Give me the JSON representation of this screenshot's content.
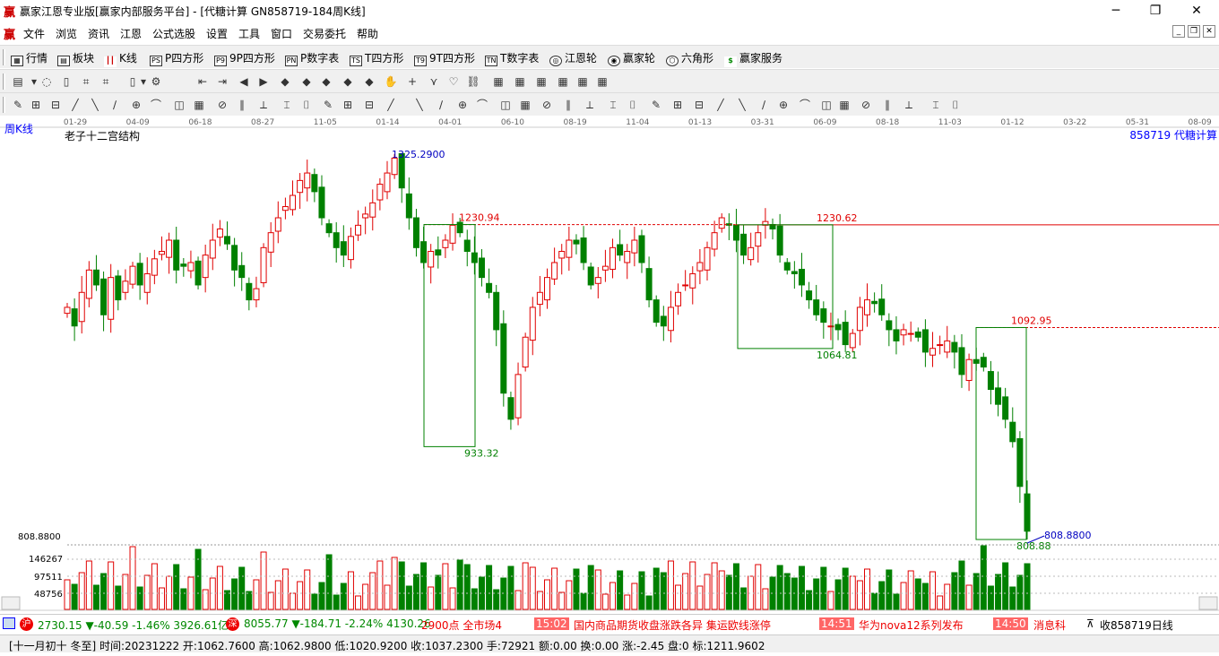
{
  "window": {
    "title": "赢家江恩专业版[赢家内部服务平台] - [代糖计算  GN858719-184周K线]",
    "logo": "赢"
  },
  "menu": [
    "文件",
    "浏览",
    "资讯",
    "江恩",
    "公式选股",
    "设置",
    "工具",
    "窗口",
    "交易委托",
    "帮助"
  ],
  "toolbar1": [
    {
      "icon": "grid-icon",
      "label": "行情"
    },
    {
      "icon": "blocks-icon",
      "label": "板块"
    },
    {
      "icon": "kline-icon",
      "label": "K线"
    },
    {
      "icon": "ps-icon",
      "label": "P四方形",
      "glyph": "PS"
    },
    {
      "icon": "p9-icon",
      "label": "9P四方形",
      "glyph": "P9"
    },
    {
      "icon": "pn-icon",
      "label": "P数字表",
      "glyph": "PN"
    },
    {
      "icon": "ts-icon",
      "label": "T四方形",
      "glyph": "TS"
    },
    {
      "icon": "t9-icon",
      "label": "9T四方形",
      "glyph": "T9"
    },
    {
      "icon": "tn-icon",
      "label": "T数字表",
      "glyph": "TN"
    },
    {
      "icon": "gann-wheel-icon",
      "label": "江恩轮"
    },
    {
      "icon": "winner-wheel-icon",
      "label": "赢家轮"
    },
    {
      "icon": "hexagon-icon",
      "label": "六角形"
    },
    {
      "icon": "dollar-icon",
      "label": "赢家服务"
    }
  ],
  "chart": {
    "period": "周K线",
    "indicator": "老子十二宫结构",
    "code_label": "858719  代糖计算",
    "date_ticks": [
      "01-29",
      "04-09",
      "06-18",
      "08-27",
      "11-05",
      "01-14",
      "04-01",
      "06-10",
      "08-19",
      "11-04",
      "01-13",
      "03-31",
      "06-09",
      "08-18",
      "11-03",
      "01-12",
      "03-22",
      "05-31",
      "08-09"
    ],
    "labels": {
      "high": "1325.2900",
      "r1": "1230.94",
      "r2": "1230.62",
      "r3": "1092.95",
      "s1": "933.32",
      "s2": "1064.81",
      "s3": "808.88",
      "low_right": "808.8800",
      "low_left": "808.8800",
      "vol1": "146267",
      "vol2": "97511",
      "vol3": "48756"
    },
    "colors": {
      "up": "#e00000",
      "down": "#008000",
      "box": "#008000",
      "resist": "#e00000",
      "price_label": "#0000c0"
    }
  },
  "chart_data": {
    "type": "candlestick",
    "title": "老子十二宫结构",
    "price_range": [
      808.88,
      1325.29
    ],
    "annotations": [
      {
        "label": "1325.2900",
        "value": 1325.29
      },
      {
        "label": "1230.94",
        "value": 1230.94
      },
      {
        "label": "1230.62",
        "value": 1230.62
      },
      {
        "label": "1092.95",
        "value": 1092.95
      },
      {
        "label": "933.32",
        "value": 933.32
      },
      {
        "label": "1064.81",
        "value": 1064.81
      },
      {
        "label": "808.88",
        "value": 808.88
      }
    ],
    "last_bar": {
      "open": 1062.76,
      "high": 1062.98,
      "low": 1020.92,
      "close": 1037.23,
      "volume": 72921
    },
    "closes": [
      1120,
      1095,
      1140,
      1170,
      1150,
      1110,
      1160,
      1130,
      1155,
      1175,
      1150,
      1165,
      1185,
      1195,
      1210,
      1170,
      1175,
      1180,
      1150,
      1190,
      1210,
      1225,
      1205,
      1170,
      1160,
      1130,
      1145,
      1200,
      1220,
      1240,
      1255,
      1270,
      1290,
      1300,
      1275,
      1240,
      1220,
      1200,
      1190,
      1215,
      1230,
      1245,
      1260,
      1285,
      1300,
      1320,
      1280,
      1240,
      1200,
      1180,
      1195,
      1190,
      1210,
      1230,
      1220,
      1195,
      1180,
      1160,
      1140,
      1090,
      1005,
      970,
      1030,
      1080,
      1120,
      1140,
      1160,
      1180,
      1195,
      1210,
      1205,
      1180,
      1150,
      1160,
      1175,
      1200,
      1190,
      1195,
      1210,
      1180,
      1130,
      1100,
      1095,
      1120,
      1140,
      1150,
      1165,
      1180,
      1200,
      1220,
      1240,
      1230,
      1210,
      1190,
      1200,
      1220,
      1235,
      1225,
      1190,
      1170,
      1165,
      1150,
      1130,
      1110,
      1100,
      1095,
      1090,
      1070,
      1085,
      1120,
      1130,
      1125,
      1110,
      1090,
      1075,
      1090,
      1085,
      1080,
      1060,
      1065,
      1070,
      1075,
      1060,
      1030,
      1050,
      1045,
      1040,
      1010,
      990,
      970,
      940,
      880,
      820
    ]
  },
  "ticker": {
    "sh": "2730.15 ▼-40.59 -1.46% 3926.61亿",
    "sz": "8055.77 ▼-184.71 -2.24% 4130.26",
    "news": "2900点 全市场4",
    "t1": "15:02",
    "n1": "国内商品期货收盘涨跌各异 集运欧线涨停",
    "t2": "14:51",
    "n2": "华为nova12系列发布",
    "t3": "14:50",
    "n3": "消息科",
    "code": "收858719日线"
  },
  "status": "[十一月初十 冬至] 时间:20231222 开:1062.7600 高:1062.9800 低:1020.9200 收:1037.2300 手:72921 额:0.00 换:0.00 涨:-2.45 盘:0 标:1211.9602"
}
